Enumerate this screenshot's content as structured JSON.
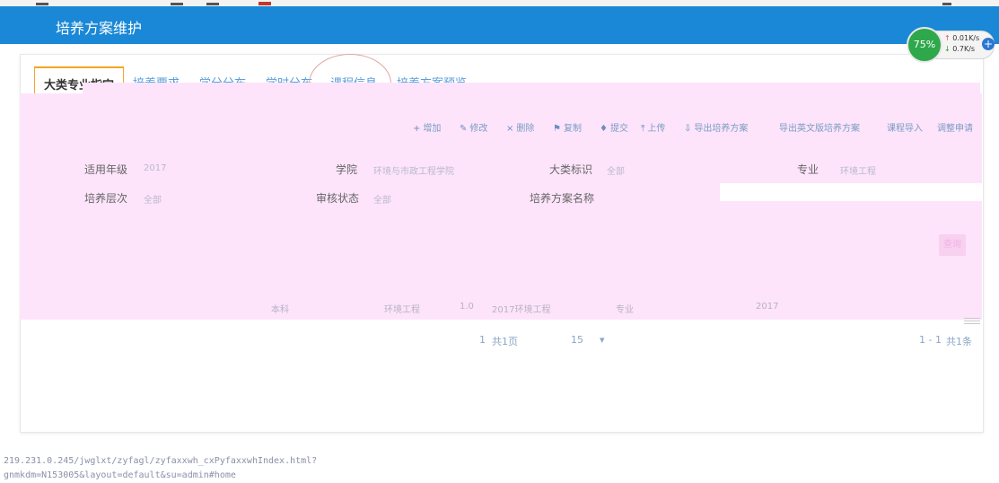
{
  "header": {
    "title": "培养方案维护"
  },
  "net_widget": {
    "percent": "75%",
    "up": "0.01K/s",
    "down": "0.7K/s",
    "plus": "+"
  },
  "tabs": [
    {
      "label": "大类专业指定"
    },
    {
      "label": "培养要求"
    },
    {
      "label": "学分分布"
    },
    {
      "label": "学时分布"
    },
    {
      "label": "课程信息"
    },
    {
      "label": "培养方案预览"
    }
  ],
  "toolbar": {
    "items": [
      {
        "icon": "plus-icon",
        "glyph": "+",
        "label": "增加"
      },
      {
        "icon": "edit-icon",
        "glyph": "✎",
        "label": "修改"
      },
      {
        "icon": "delete-icon",
        "glyph": "×",
        "label": "删除"
      },
      {
        "icon": "flag-icon",
        "glyph": "⚑",
        "label": "复制"
      },
      {
        "icon": "submit-icon",
        "glyph": "♦",
        "label": "提交"
      },
      {
        "icon": "upload-icon",
        "glyph": "⤒",
        "label": "上传"
      },
      {
        "icon": "export-icon",
        "glyph": "⇩",
        "label": "导出培养方案"
      },
      {
        "icon": "export-doc-icon",
        "glyph": "",
        "label": "导出英文版培养方案"
      },
      {
        "icon": "course-icon",
        "glyph": "",
        "label": "课程导入"
      },
      {
        "icon": "apply-icon",
        "glyph": "",
        "label": "调整申请"
      }
    ]
  },
  "filters": {
    "year_label": "适用年级",
    "year_value": "2017",
    "college_label": "学院",
    "college_value": "环境与市政工程学院",
    "category_label": "大类标识",
    "category_value": "全部",
    "major_label": "专业",
    "major_value": "环境工程",
    "level_label": "培养层次",
    "level_value": "全部",
    "audit_label": "审核状态",
    "audit_value": "全部",
    "name_label": "培养方案名称"
  },
  "search_button": "查询",
  "table": {
    "row": {
      "level": "本科",
      "major": "环境工程",
      "version": "1.0",
      "plan_name": "2017环境工程",
      "type": "专业",
      "year": "2017"
    }
  },
  "pager": {
    "page": "1",
    "total": "共1页",
    "size": "15",
    "range": "1 - 1",
    "count": "共1条"
  },
  "status_bar": {
    "url": "219.231.0.245/jwglxt/zyfagl/zyfaxxwh_cxPyfaxxwhIndex.html?gnmkdm=N153005&layout=default&su=admin#home"
  }
}
